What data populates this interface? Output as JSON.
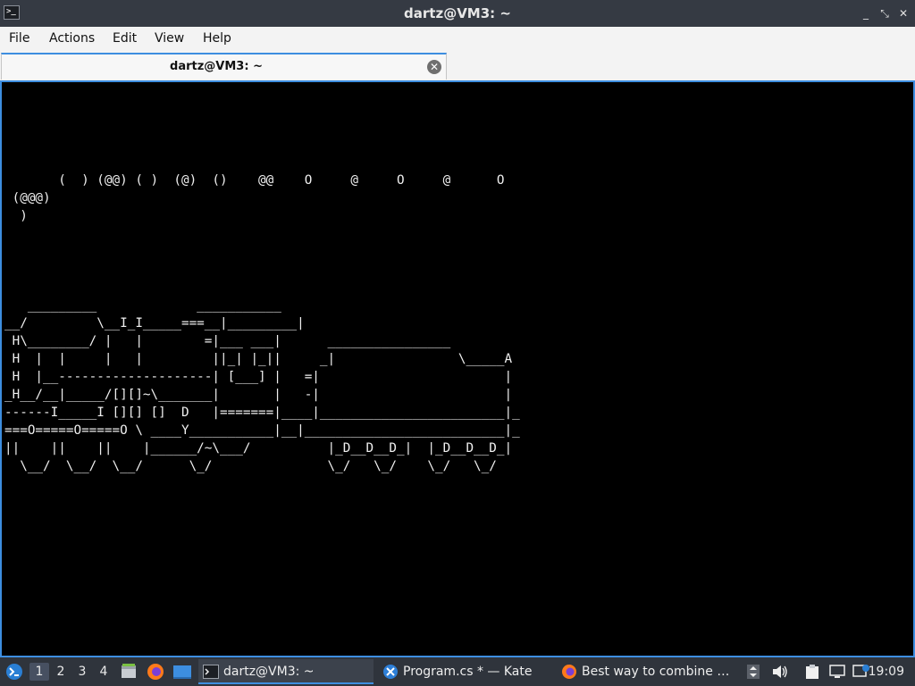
{
  "window": {
    "title": "dartz@VM3: ~",
    "app_icon_text": ">_",
    "controls": {
      "minimize": "_",
      "maximize": "⤡",
      "close": "✕"
    }
  },
  "menu": [
    "File",
    "Actions",
    "Edit",
    "View",
    "Help"
  ],
  "tab": {
    "label": "dartz@VM3: ~"
  },
  "terminal": {
    "lines": [
      "",
      "",
      "",
      "",
      "",
      "       (  ) (@@) ( )  (@)  ()    @@    O     @     O     @      O",
      " (@@@)",
      "  )",
      "",
      "",
      "",
      "",
      "   _________             ___________",
      "__/         \\__I_I_____===__|_________|",
      " H\\________/ |   |        =|___ ___|      ________________",
      " H  |  |     |   |         ||_| |_||     _|                \\_____A",
      " H  |__--------------------| [___] |   =|                        |",
      "_H__/__|_____/[][]~\\_______|       |   -|                        |",
      "------I_____I [][] []  D   |=======|____|________________________|_",
      "===O=====O=====O \\ ____Y___________|__|__________________________|_",
      "||    ||    ||    |______/~\\___/          |_D__D__D_|  |_D__D__D_|",
      "  \\__/  \\__/  \\__/      \\_/               \\_/   \\_/    \\_/   \\_/"
    ]
  },
  "taskbar": {
    "workspaces": [
      "1",
      "2",
      "3",
      "4"
    ],
    "active_workspace": "1",
    "tasks": [
      {
        "label": "dartz@VM3: ~",
        "icon": "terminal-icon",
        "active": true
      },
      {
        "label": "Program.cs * — Kate",
        "icon": "kate-icon",
        "active": false
      },
      {
        "label": "Best way to combine …",
        "icon": "firefox-icon",
        "active": false
      }
    ],
    "clock": "19:09"
  },
  "colors": {
    "accent": "#3d8ee0",
    "titlebar": "#353a43",
    "taskbar": "#2f343c",
    "terminal_bg": "#000000",
    "terminal_fg": "#f0f0f0"
  }
}
